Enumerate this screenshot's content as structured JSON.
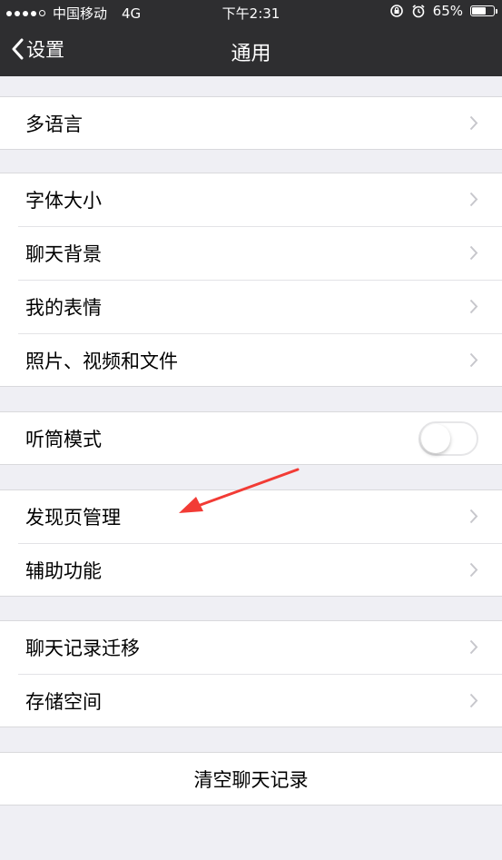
{
  "status_bar": {
    "carrier": "中国移动",
    "network": "4G",
    "time": "下午2:31",
    "battery_percent": "65%",
    "battery_level": 0.65,
    "signal_bars_filled": 4,
    "icons": [
      "rotation-lock-icon",
      "alarm-icon",
      "battery-icon"
    ]
  },
  "nav": {
    "back_label": "设置",
    "title": "通用"
  },
  "groups": [
    {
      "items": [
        {
          "label": "多语言"
        }
      ]
    },
    {
      "items": [
        {
          "label": "字体大小"
        },
        {
          "label": "聊天背景"
        },
        {
          "label": "我的表情"
        },
        {
          "label": "照片、视频和文件"
        }
      ]
    },
    {
      "items": [
        {
          "label": "听筒模式",
          "toggle": false
        }
      ]
    },
    {
      "items": [
        {
          "label": "发现页管理"
        },
        {
          "label": "辅助功能"
        }
      ]
    },
    {
      "items": [
        {
          "label": "聊天记录迁移"
        },
        {
          "label": "存储空间"
        }
      ]
    }
  ],
  "clear_chat_label": "清空聊天记录",
  "colors": {
    "nav_bg": "#2e2e30",
    "page_bg": "#efeff4",
    "annotation_arrow": "#f23b35"
  }
}
